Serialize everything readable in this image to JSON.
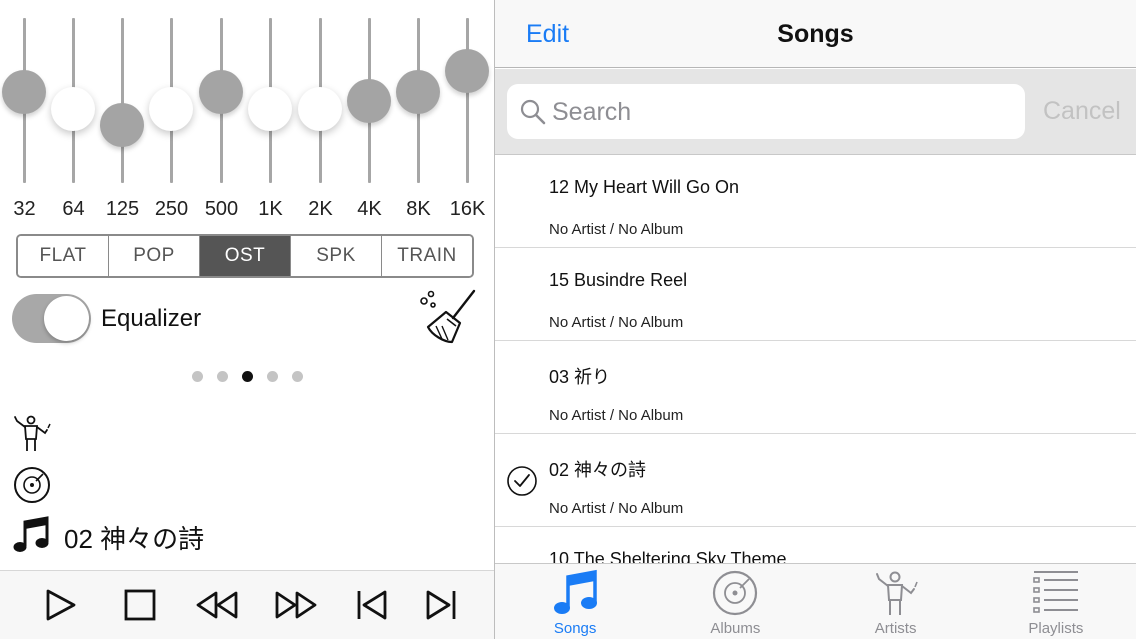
{
  "equalizer": {
    "bands": [
      {
        "label": "32",
        "level": 0.55,
        "knob": "grey"
      },
      {
        "label": "64",
        "level": 0.45,
        "knob": "white"
      },
      {
        "label": "125",
        "level": 0.35,
        "knob": "grey"
      },
      {
        "label": "250",
        "level": 0.45,
        "knob": "white"
      },
      {
        "label": "500",
        "level": 0.55,
        "knob": "grey"
      },
      {
        "label": "1K",
        "level": 0.45,
        "knob": "white"
      },
      {
        "label": "2K",
        "level": 0.45,
        "knob": "white"
      },
      {
        "label": "4K",
        "level": 0.5,
        "knob": "grey"
      },
      {
        "label": "8K",
        "level": 0.55,
        "knob": "grey"
      },
      {
        "label": "16K",
        "level": 0.68,
        "knob": "grey"
      }
    ],
    "presets": [
      "FLAT",
      "POP",
      "OST",
      "SPK",
      "TRAIN"
    ],
    "active_preset": "OST",
    "toggle_label": "Equalizer",
    "toggle_on": true,
    "page_dots": 5,
    "active_dot": 3
  },
  "now_playing": {
    "title": "02 神々の詩"
  },
  "player_controls": [
    "play-icon",
    "stop-icon",
    "rewind-icon",
    "fast-forward-icon",
    "previous-track-icon",
    "next-track-icon"
  ],
  "navbar": {
    "edit_label": "Edit",
    "title": "Songs"
  },
  "search": {
    "placeholder": "Search",
    "cancel_label": "Cancel"
  },
  "songs": [
    {
      "title": "12 My Heart Will Go On",
      "subtitle": "No Artist / No Album",
      "checked": false
    },
    {
      "title": "15 Busindre Reel",
      "subtitle": "No Artist / No Album",
      "checked": false
    },
    {
      "title": "03 祈り",
      "subtitle": "No Artist / No Album",
      "checked": false
    },
    {
      "title": "02 神々の詩",
      "subtitle": "No Artist / No Album",
      "checked": true
    },
    {
      "title": "10 The Sheltering Sky Theme",
      "subtitle": "",
      "checked": false
    }
  ],
  "tabs": [
    {
      "label": "Songs",
      "icon": "music-note-icon",
      "active": true
    },
    {
      "label": "Albums",
      "icon": "vinyl-disc-icon",
      "active": false
    },
    {
      "label": "Artists",
      "icon": "conductor-icon",
      "active": false
    },
    {
      "label": "Playlists",
      "icon": "list-icon",
      "active": false
    }
  ],
  "colors": {
    "accent": "#1a7cf5",
    "knob_grey": "#a4a4a4",
    "preset_active": "#555555"
  }
}
